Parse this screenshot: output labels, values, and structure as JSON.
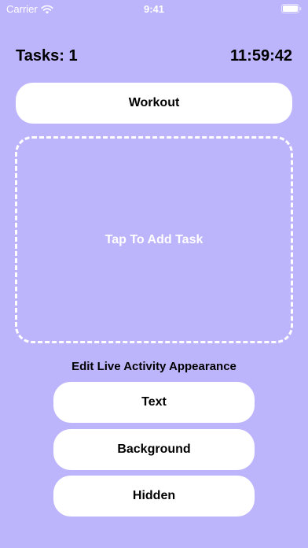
{
  "status_bar": {
    "carrier": "Carrier",
    "time": "9:41",
    "icons": [
      "wifi-icon",
      "battery-icon"
    ]
  },
  "header": {
    "tasks_label": "Tasks: 1",
    "timer": "11:59:42"
  },
  "workout_button": {
    "label": "Workout"
  },
  "add_task": {
    "label": "Tap To Add Task"
  },
  "live_activity": {
    "title": "Edit Live Activity Appearance",
    "options": [
      {
        "label": "Text"
      },
      {
        "label": "Background"
      },
      {
        "label": "Hidden"
      }
    ]
  },
  "colors": {
    "background": "#bcb5fb",
    "button": "#ffffff",
    "text": "#000000",
    "dashed_border": "#ffffff"
  }
}
